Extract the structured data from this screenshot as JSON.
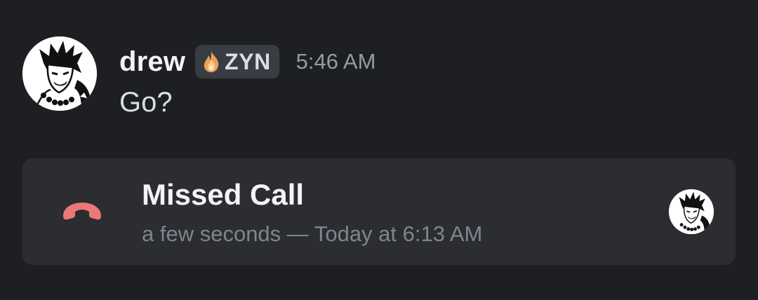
{
  "message": {
    "author": "drew",
    "tag": {
      "icon": "flame-icon",
      "label": "ZYN"
    },
    "time": "5:46 AM",
    "content": "Go?"
  },
  "call": {
    "icon": "phone-hangup-icon",
    "icon_color": "#ed7777",
    "title": "Missed Call",
    "meta": "a few seconds — Today at 6:13 AM"
  },
  "colors": {
    "background": "#1e1f22",
    "card": "#2b2d31",
    "tag_bg": "#3a3c43",
    "muted_text": "#949ba4"
  }
}
